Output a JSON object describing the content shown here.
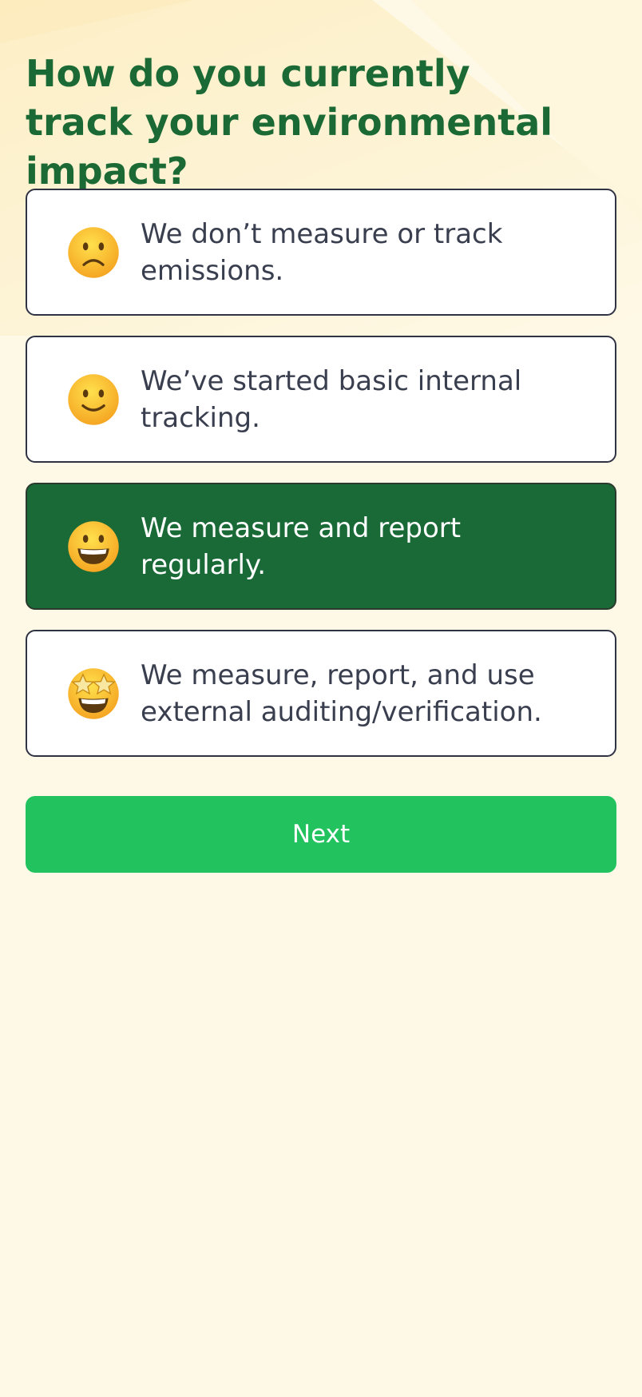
{
  "page": {
    "title": "How do you currently track your environmental impact?"
  },
  "options": [
    {
      "emoji": "slightly-frowning-face-icon",
      "label": "We don’t measure or track emissions.",
      "selected": false
    },
    {
      "emoji": "slightly-smiling-face-icon",
      "label": "We’ve started basic internal tracking.",
      "selected": false
    },
    {
      "emoji": "grinning-face-icon",
      "label": "We measure and report regularly.",
      "selected": true
    },
    {
      "emoji": "star-struck-face-icon",
      "label": "We measure, report, and use external auditing/verification.",
      "selected": false
    }
  ],
  "next_button": {
    "label": "Next"
  },
  "colors": {
    "background": "#fef9e7",
    "title": "#1b6a35",
    "selected_option": "#196a37",
    "option_border": "#2f3344",
    "option_text": "#3a3f4f",
    "next_button": "#22c35e",
    "emoji_face": "#fbb820"
  }
}
